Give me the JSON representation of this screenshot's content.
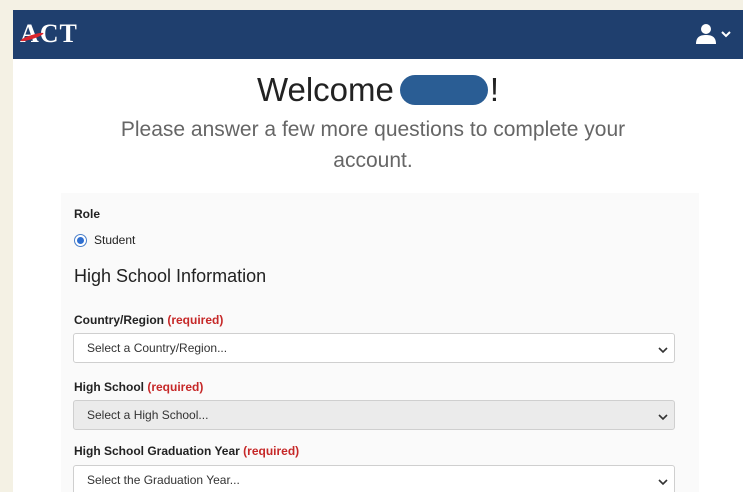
{
  "header": {
    "logo_text": "ACT",
    "user_menu_icon": "user-icon",
    "chevron_icon": "chevron-down-icon"
  },
  "welcome": {
    "prefix": "Welcome",
    "suffix": "!"
  },
  "subtitle": "Please answer a few more questions to complete your account.",
  "form": {
    "role": {
      "label": "Role",
      "option": "Student",
      "selected": true
    },
    "section_title": "High School Information",
    "country": {
      "label": "Country/Region",
      "required": "(required)",
      "placeholder": "Select a Country/Region..."
    },
    "high_school": {
      "label": "High School",
      "required": "(required)",
      "placeholder": "Select a High School..."
    },
    "grad_year": {
      "label": "High School Graduation Year",
      "required": "(required)",
      "placeholder": "Select the Graduation Year..."
    }
  },
  "colors": {
    "header_bg": "#1f3f6e",
    "required": "#c62828",
    "accent": "#2f6fd0"
  }
}
